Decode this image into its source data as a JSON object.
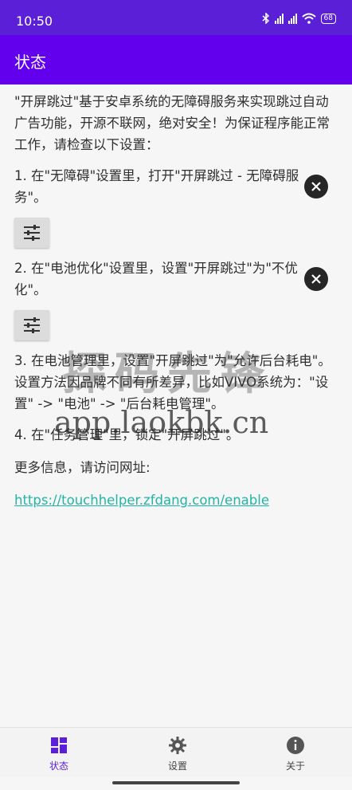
{
  "statusbar": {
    "time": "10:50",
    "battery": "68"
  },
  "appbar": {
    "title": "状态"
  },
  "intro": "\"开屏跳过\"基于安卓系统的无障碍服务来实现跳过自动广告功能，开源不联网，绝对安全！为保证程序能正常工作，请检查以下设置：",
  "steps": [
    {
      "text": "1. 在\"无障碍\"设置里，打开\"开屏跳过 - 无障碍服务\"。"
    },
    {
      "text": "2. 在\"电池优化\"设置里，设置\"开屏跳过\"为\"不优化\"。"
    },
    {
      "text": "3. 在电池管理里，设置\"开屏跳过\"为\"允许后台耗电\"。设置方法因品牌不同有所差异，比如VIVO系统为：\"设置\" -> \"电池\" -> \"后台耗电管理\"。"
    },
    {
      "text": "4. 在\"任务管理\"里，锁定\"开屏跳过\"。"
    }
  ],
  "more_info": "更多信息，请访问网址:",
  "link": "https://touchhelper.zfdang.com/enable",
  "watermark": {
    "brand": "探码先锋",
    "site": "app.laokbk.cn"
  },
  "bottom_nav": [
    {
      "label": "状态",
      "icon": "dashboard-icon",
      "active": true
    },
    {
      "label": "设置",
      "icon": "gear-icon",
      "active": false
    },
    {
      "label": "关于",
      "icon": "info-icon",
      "active": false
    }
  ],
  "colors": {
    "primary": "#6200ee",
    "statusbar": "#5a1fd6",
    "link": "#22b5a6"
  }
}
